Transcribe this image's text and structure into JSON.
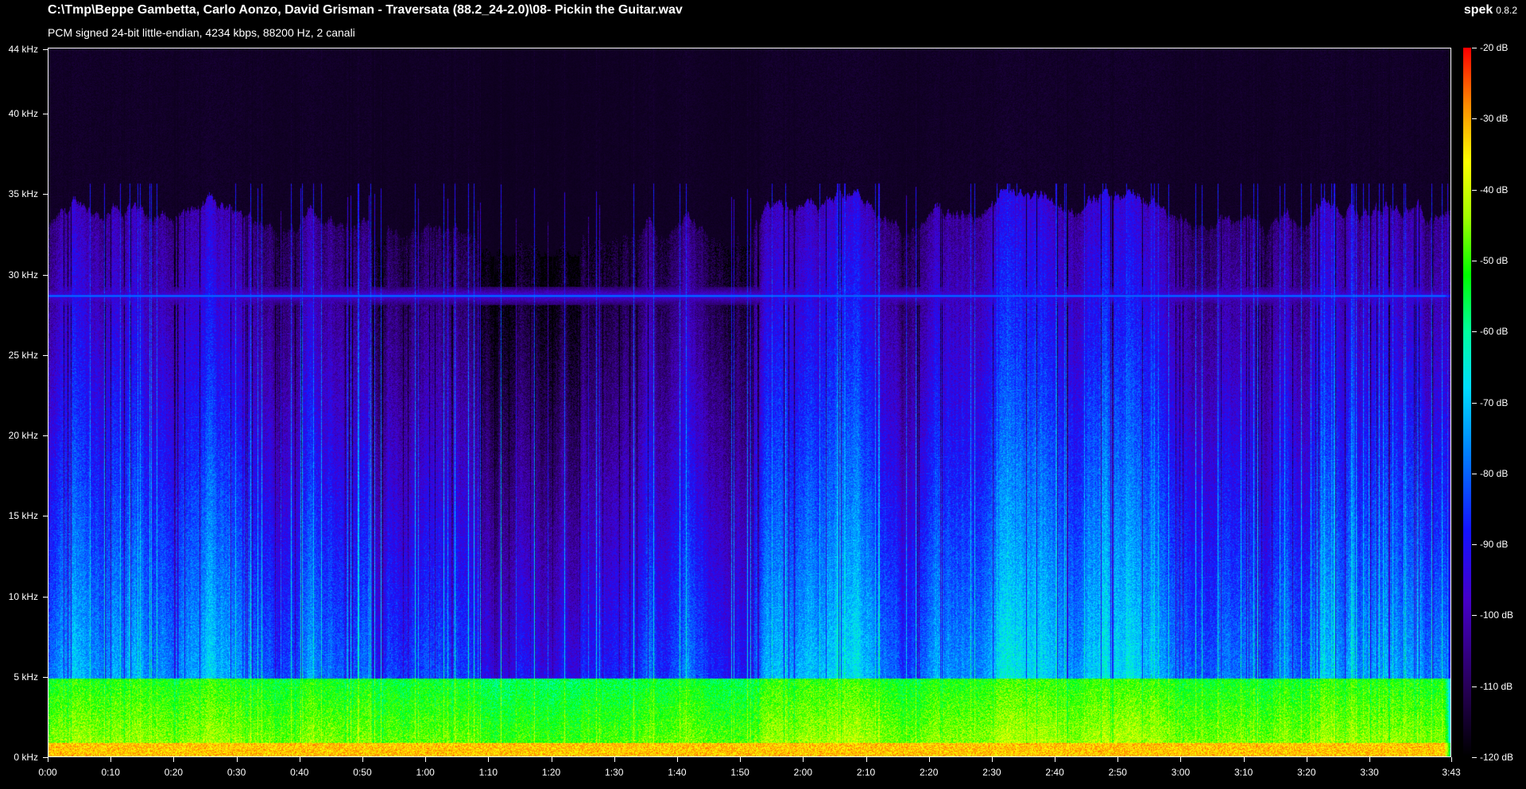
{
  "header": {
    "file_path": "C:\\Tmp\\Beppe Gambetta, Carlo Aonzo, David Grisman - Traversata (88.2_24-2.0)\\08- Pickin the Guitar.wav",
    "stream_info": "PCM signed 24-bit little-endian, 4234 kbps, 88200 Hz, 2 canali",
    "app_name": "spek",
    "app_version": "0.8.2"
  },
  "colors": {
    "background": "#000000",
    "text": "#ffffff",
    "palette_low": "#000000",
    "palette_mid_blue": "#0000ff",
    "palette_cyan": "#00d8ff",
    "palette_green": "#00ff00",
    "palette_yellow": "#ffff00",
    "palette_red": "#ff0000"
  },
  "spectrogram": {
    "frequency_axis": [
      "0 kHz",
      "5 kHz",
      "10 kHz",
      "15 kHz",
      "20 kHz",
      "25 kHz",
      "30 kHz",
      "35 kHz",
      "40 kHz",
      "44 kHz"
    ],
    "time_axis": [
      "0:00",
      "0:10",
      "0:20",
      "0:30",
      "0:40",
      "0:50",
      "1:00",
      "1:10",
      "1:20",
      "1:30",
      "1:40",
      "1:50",
      "2:00",
      "2:10",
      "2:20",
      "2:30",
      "2:40",
      "2:50",
      "3:00",
      "3:10",
      "3:20",
      "3:30",
      "3:43"
    ],
    "db_scale": [
      "-20 dB",
      "-30 dB",
      "-40 dB",
      "-50 dB",
      "-60 dB",
      "-70 dB",
      "-80 dB",
      "-90 dB",
      "-100 dB",
      "-110 dB",
      "-120 dB"
    ],
    "freq_max_khz": 44.1,
    "duration_s": 223,
    "db_range": [
      -120,
      -20
    ],
    "tone_line_khz": 28.7,
    "content_ceiling_khz": 35
  }
}
